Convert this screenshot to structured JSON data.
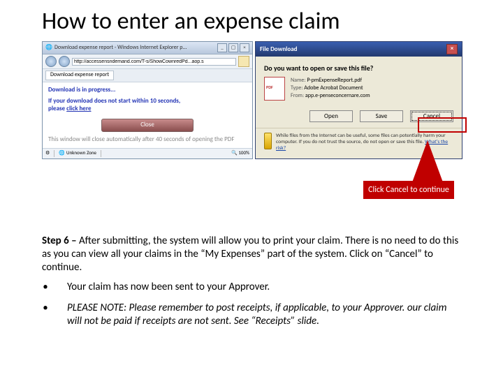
{
  "title": "How to enter an expense claim",
  "ie": {
    "window_title": "Download expense report - Windows Internet Explorer p...",
    "url": "http://accessensndemand.com/T-s/ShowCownredPd...aop.s",
    "tab": "Download expense report",
    "heading": "Download is in progress...",
    "waitmsg_a": "If your download does not start within 10 seconds,",
    "waitmsg_b": "please ",
    "clickhere": "click here",
    "close": "Close",
    "autoclose": "This window will close automatically after 40 seconds of opening the PDF",
    "zone": "Unknown Zone",
    "zoom": "100%"
  },
  "fd": {
    "title": "File Download",
    "question": "Do you want to open or save this file?",
    "name_lbl": "Name:",
    "name_val": "P-pmExpenseReport.pdf",
    "type_lbl": "Type:",
    "type_val": "Adobe Acrobat Document",
    "from_lbl": "From:",
    "from_val": "app.e-penseconcernare.com",
    "open": "Open",
    "save": "Save",
    "cancel": "Cancel",
    "warn": "While files from the Internet can be useful, some files can potentially harm your computer. If you do not trust the source, do not open or save this file.",
    "risk": "What's the risk?"
  },
  "callout": "Click Cancel to continue",
  "step6_label": "Step 6 –",
  "step6_text": "After submitting, the system will allow you to print your claim. There is no need to do this as you can view all your claims in the “My Expenses” part of the system. Click on “Cancel” to continue.",
  "bullet1": "Your claim has now been sent to your Approver.",
  "bullet2": "PLEASE NOTE: Please remember to post receipts, if applicable, to your Approver. our claim will not be paid if receipts are not sent. See “Receipts” slide."
}
